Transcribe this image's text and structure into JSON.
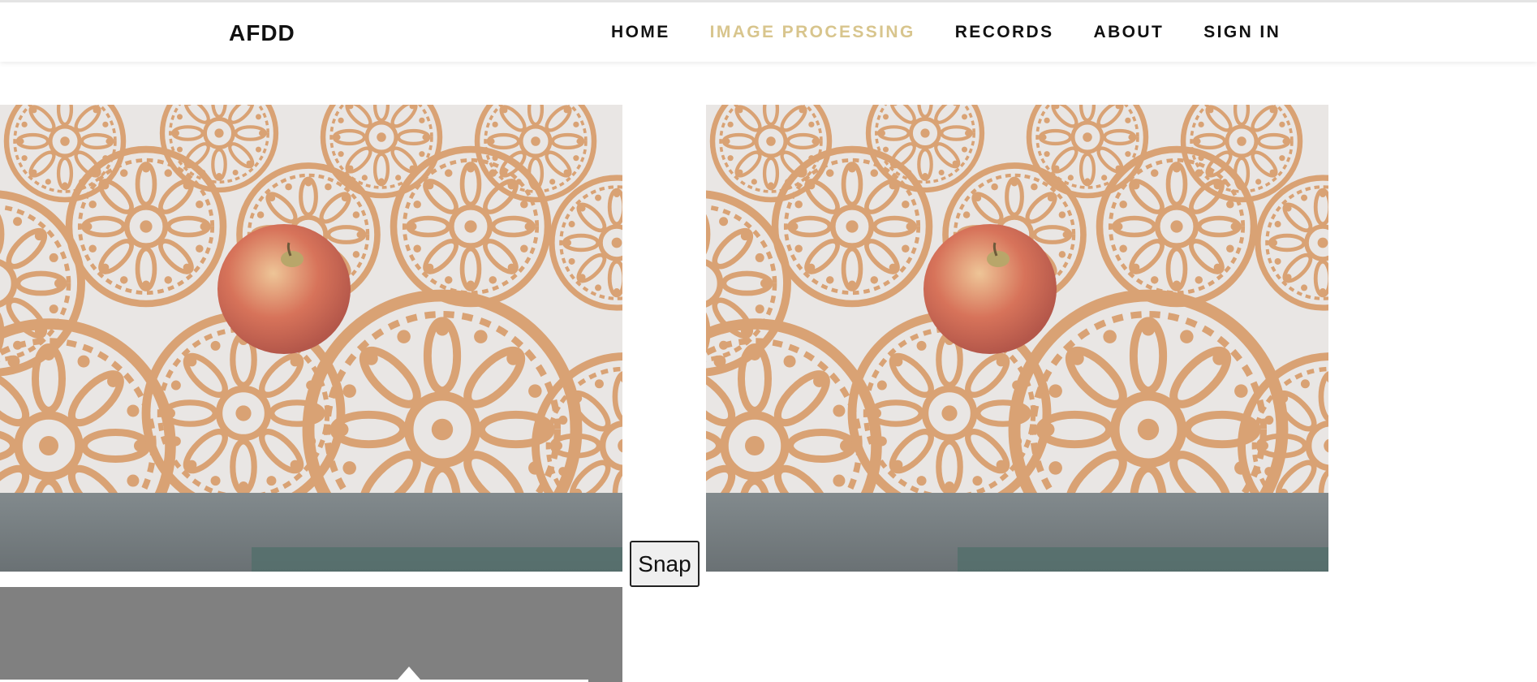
{
  "brand": "AFDD",
  "nav": {
    "items": [
      {
        "label": "HOME",
        "active": false
      },
      {
        "label": "IMAGE PROCESSING",
        "active": true
      },
      {
        "label": "RECORDS",
        "active": false
      },
      {
        "label": "ABOUT",
        "active": false
      },
      {
        "label": "SIGN IN",
        "active": false
      }
    ],
    "active_color": "#d8c58d"
  },
  "camera": {
    "live_feed_icon": "webcam-feed",
    "snapshot_icon": "captured-photo"
  },
  "snap_button": {
    "label": "Snap"
  },
  "colors": {
    "tablecloth": "#e9e6e4",
    "pattern": "#d9a274",
    "apple": "#d7735a",
    "table_edge": "#6a7174",
    "panel": "#808080"
  }
}
